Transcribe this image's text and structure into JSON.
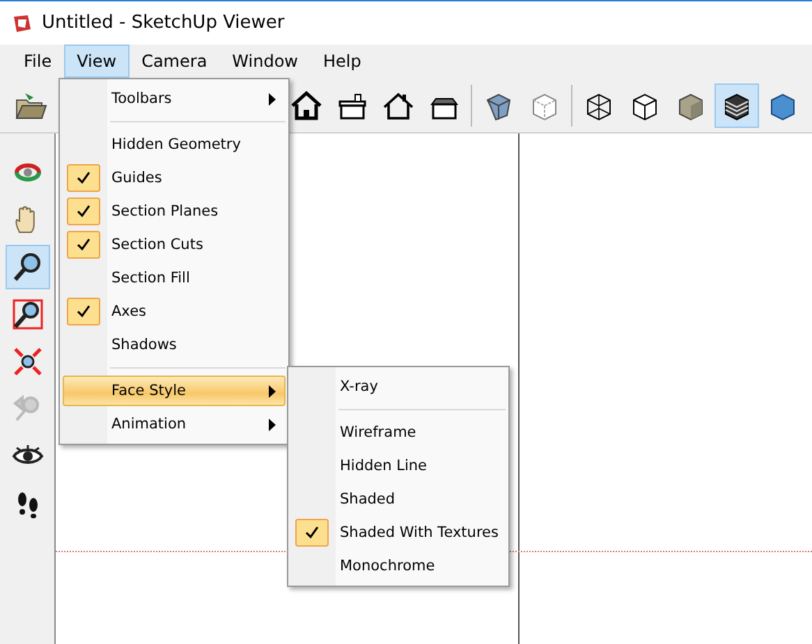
{
  "window": {
    "title": "Untitled - SketchUp Viewer"
  },
  "menubar": [
    {
      "label": "File",
      "selected": false
    },
    {
      "label": "View",
      "selected": true
    },
    {
      "label": "Camera",
      "selected": false
    },
    {
      "label": "Window",
      "selected": false
    },
    {
      "label": "Help",
      "selected": false
    }
  ],
  "top_toolbar": [
    {
      "kind": "open",
      "selected": false
    },
    {
      "kind": "home",
      "selected": false
    },
    {
      "kind": "house-front",
      "selected": false
    },
    {
      "kind": "house-outline",
      "selected": false
    },
    {
      "kind": "house-side",
      "selected": false
    },
    {
      "kind": "xray-cube",
      "selected": false
    },
    {
      "kind": "back-edges-cube",
      "selected": false
    },
    {
      "kind": "wire-cube",
      "selected": false
    },
    {
      "kind": "hidden-cube",
      "selected": false
    },
    {
      "kind": "shaded-cube",
      "selected": false
    },
    {
      "kind": "textured-cube",
      "selected": true
    },
    {
      "kind": "mono-cube",
      "selected": false
    }
  ],
  "left_toolbar": [
    {
      "kind": "orbit",
      "selected": false,
      "disabled": false
    },
    {
      "kind": "pan",
      "selected": false,
      "disabled": false
    },
    {
      "kind": "zoom",
      "selected": true,
      "disabled": false
    },
    {
      "kind": "zoom-window",
      "selected": false,
      "disabled": false
    },
    {
      "kind": "zoom-extents",
      "selected": false,
      "disabled": false
    },
    {
      "kind": "previous",
      "selected": false,
      "disabled": true
    },
    {
      "kind": "look",
      "selected": false,
      "disabled": false
    },
    {
      "kind": "walk",
      "selected": false,
      "disabled": false
    }
  ],
  "view_menu": [
    {
      "kind": "item",
      "label": "Toolbars",
      "checked": false,
      "submenu": true,
      "selected": false
    },
    {
      "kind": "separator"
    },
    {
      "kind": "item",
      "label": "Hidden Geometry",
      "checked": false,
      "submenu": false,
      "selected": false
    },
    {
      "kind": "item",
      "label": "Guides",
      "checked": true,
      "submenu": false,
      "selected": false
    },
    {
      "kind": "item",
      "label": "Section Planes",
      "checked": true,
      "submenu": false,
      "selected": false
    },
    {
      "kind": "item",
      "label": "Section Cuts",
      "checked": true,
      "submenu": false,
      "selected": false
    },
    {
      "kind": "item",
      "label": "Section Fill",
      "checked": false,
      "submenu": false,
      "selected": false
    },
    {
      "kind": "item",
      "label": "Axes",
      "checked": true,
      "submenu": false,
      "selected": false
    },
    {
      "kind": "item",
      "label": "Shadows",
      "checked": false,
      "submenu": false,
      "selected": false
    },
    {
      "kind": "separator"
    },
    {
      "kind": "item",
      "label": "Face Style",
      "checked": false,
      "submenu": true,
      "selected": true
    },
    {
      "kind": "item",
      "label": "Animation",
      "checked": false,
      "submenu": true,
      "selected": false
    }
  ],
  "face_style_menu": [
    {
      "kind": "item",
      "label": "X-ray",
      "checked": false,
      "submenu": false,
      "selected": false
    },
    {
      "kind": "separator"
    },
    {
      "kind": "item",
      "label": "Wireframe",
      "checked": false,
      "submenu": false,
      "selected": false
    },
    {
      "kind": "item",
      "label": "Hidden Line",
      "checked": false,
      "submenu": false,
      "selected": false
    },
    {
      "kind": "item",
      "label": "Shaded",
      "checked": false,
      "submenu": false,
      "selected": false
    },
    {
      "kind": "item",
      "label": "Shaded With Textures",
      "checked": true,
      "submenu": false,
      "selected": false
    },
    {
      "kind": "item",
      "label": "Monochrome",
      "checked": false,
      "submenu": false,
      "selected": false
    }
  ]
}
